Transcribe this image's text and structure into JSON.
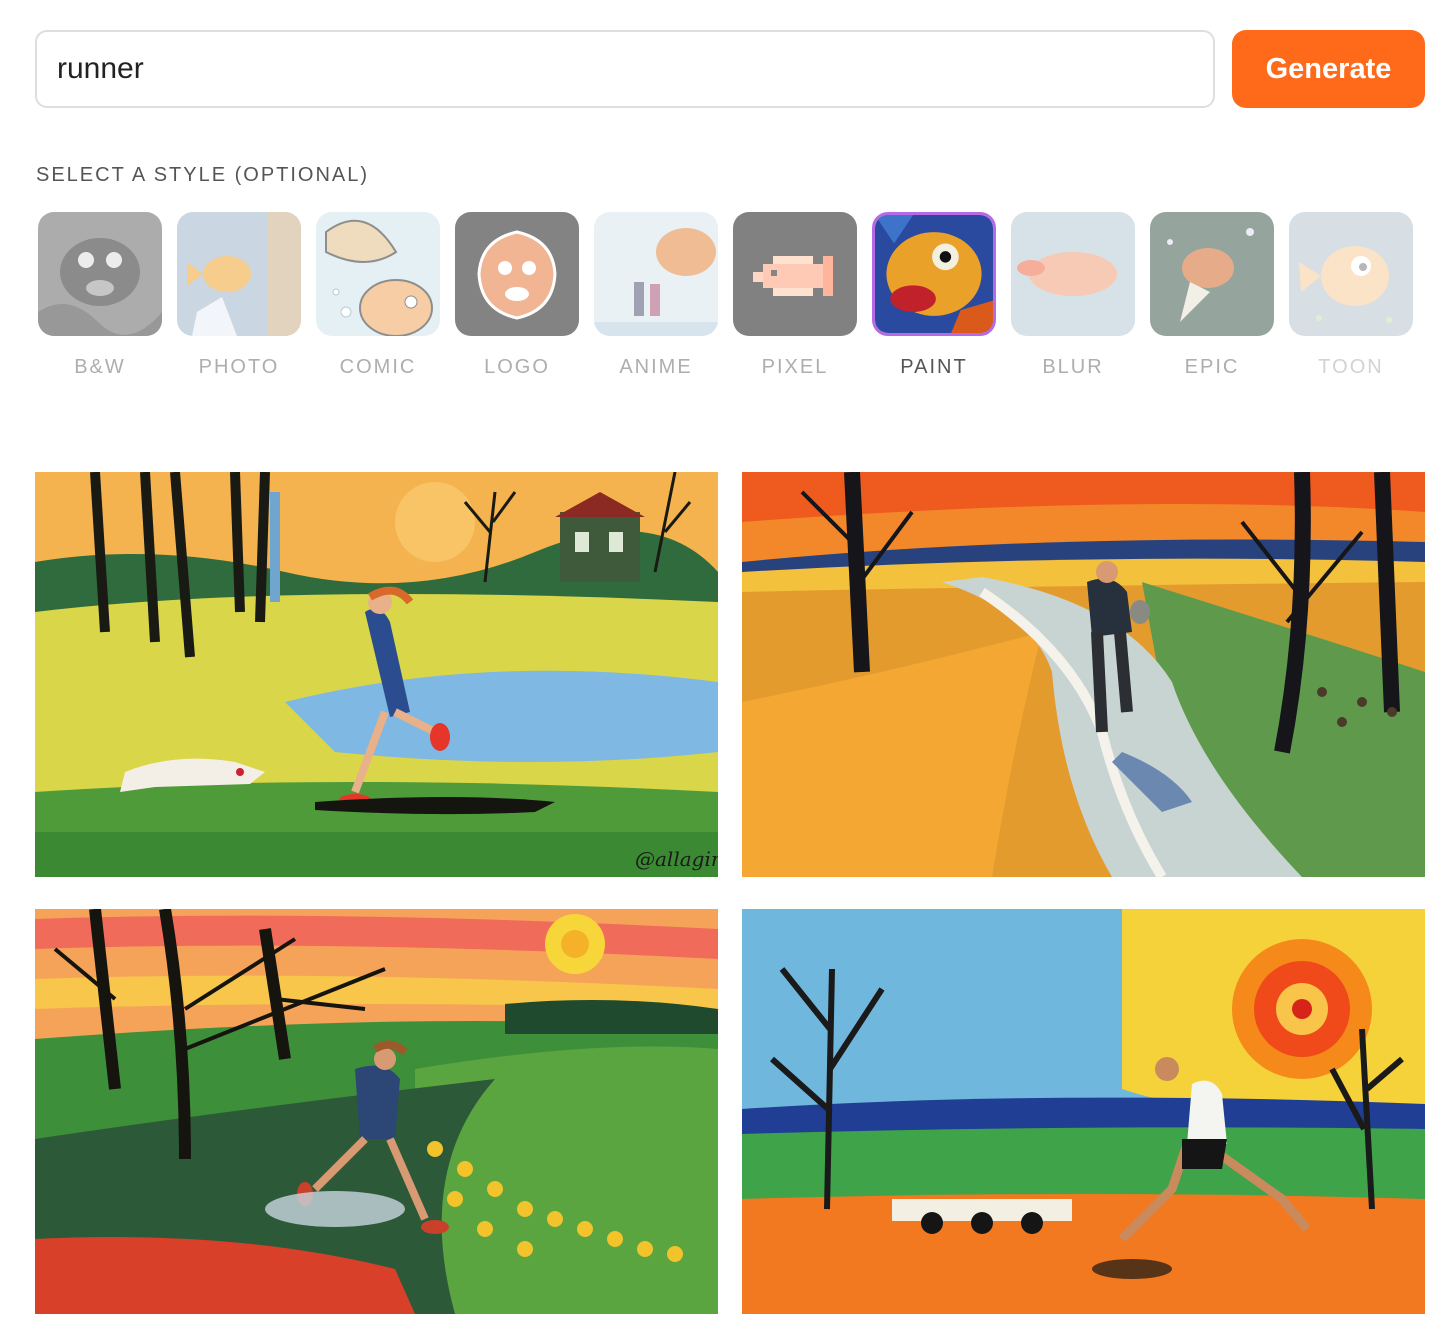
{
  "search": {
    "value": "runner"
  },
  "generate_label": "Generate",
  "style_heading": "SELECT A STYLE (OPTIONAL)",
  "styles": [
    {
      "label": "B&W",
      "selected": false
    },
    {
      "label": "PHOTO",
      "selected": false
    },
    {
      "label": "COMIC",
      "selected": false
    },
    {
      "label": "LOGO",
      "selected": false
    },
    {
      "label": "ANIME",
      "selected": false
    },
    {
      "label": "PIXEL",
      "selected": false
    },
    {
      "label": "PAINT",
      "selected": true
    },
    {
      "label": "BLUR",
      "selected": false
    },
    {
      "label": "EPIC",
      "selected": false
    },
    {
      "label": "TOON",
      "selected": false
    }
  ],
  "colors": {
    "accent": "#ff6a1a",
    "selected_border": "#b66ae6"
  },
  "results": [
    {
      "signature": "@allaginn"
    },
    {
      "signature": ""
    },
    {
      "signature": ""
    },
    {
      "signature": ""
    }
  ]
}
